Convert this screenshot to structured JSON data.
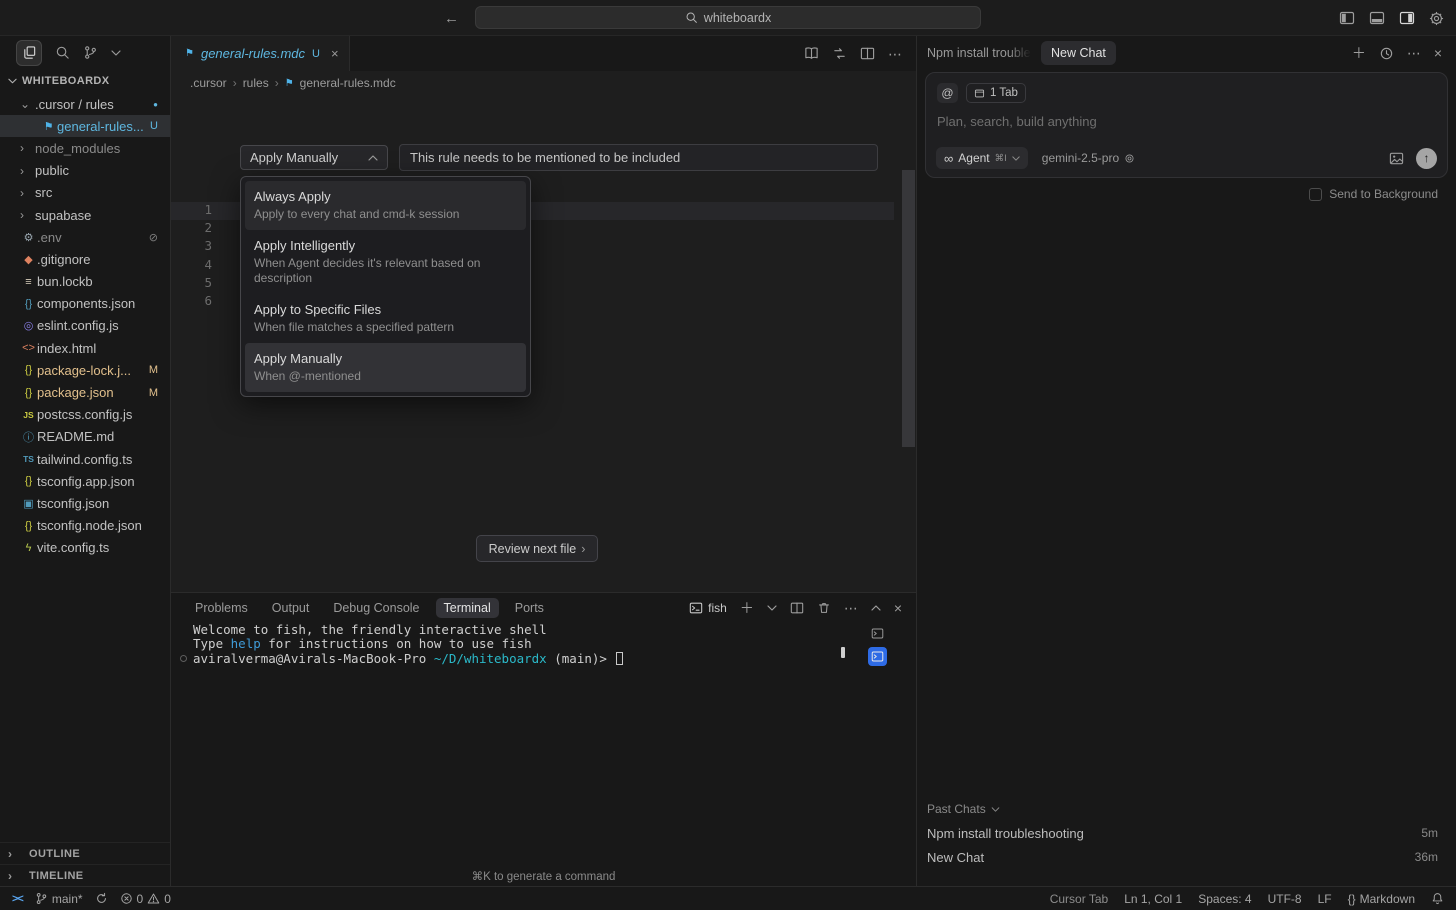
{
  "colors": {
    "untracked": "#5eb7e0",
    "modified": "#e2c08d",
    "accent": "#4daafc",
    "terminal_path": "#2bb9c9",
    "terminal_command": "#3f9bd8",
    "active_terminal_tile": "#2e6be5",
    "remote": "#5aa7f2"
  },
  "title_bar": {
    "search": "whiteboardx"
  },
  "sidebar": {
    "root_label": "WHITEBOARDX",
    "items": [
      {
        "chev": "⌄",
        "name": ".cursor / rules",
        "badge": "●",
        "badge_class": "b-dot"
      },
      {
        "glyph": "⚑",
        "glyph_class": "ic-rule",
        "name": "general-rules....",
        "name_class": "untracked",
        "badge": "U",
        "badge_class": "b-u",
        "row_class": "selected ind1"
      },
      {
        "chev": "›",
        "name": "node_modules",
        "name_class": "dim"
      },
      {
        "chev": "›",
        "name": "public"
      },
      {
        "chev": "›",
        "name": "src"
      },
      {
        "chev": "›",
        "name": "supabase"
      },
      {
        "glyph": "⚙",
        "glyph_class": "ic-gray",
        "name": ".env",
        "name_class": "dim",
        "badge": "⊘",
        "badge_class": "b-ign"
      },
      {
        "glyph": "◆",
        "glyph_class": "ic-orange",
        "name": ".gitignore"
      },
      {
        "glyph": "≡",
        "glyph_class": "ic-beige",
        "name": "bun.lockb"
      },
      {
        "glyph": "{}",
        "glyph_class": "ic-teal",
        "name": "components.json"
      },
      {
        "glyph": "◎",
        "glyph_class": "ic-purple",
        "name": "eslint.config.js"
      },
      {
        "glyph": "<>",
        "glyph_class": "ic-orange",
        "name": "index.html"
      },
      {
        "glyph": "{}",
        "glyph_class": "ic-yellow",
        "name": "package-lock.j...",
        "name_class": "modified",
        "badge": "M",
        "badge_class": "b-m"
      },
      {
        "glyph": "{}",
        "glyph_class": "ic-yellow",
        "name": "package.json",
        "name_class": "modified",
        "badge": "M",
        "badge_class": "b-m"
      },
      {
        "glyph": "JS",
        "glyph_class": "ic-yellow ic-txt",
        "name": "postcss.config.js"
      },
      {
        "glyph": "ⓘ",
        "glyph_class": "ic-blue",
        "name": "README.md"
      },
      {
        "glyph": "TS",
        "glyph_class": "ic-blue ic-txt",
        "name": "tailwind.config.ts"
      },
      {
        "glyph": "{}",
        "glyph_class": "ic-yellow",
        "name": "tsconfig.app.json"
      },
      {
        "glyph": "▣",
        "glyph_class": "ic-blue",
        "name": "tsconfig.json"
      },
      {
        "glyph": "{}",
        "glyph_class": "ic-yellow",
        "name": "tsconfig.node.json"
      },
      {
        "glyph": "ϟ",
        "glyph_class": "ic-lime",
        "name": "vite.config.ts"
      }
    ],
    "outline_label": "OUTLINE",
    "timeline_label": "TIMELINE"
  },
  "editor": {
    "tab": {
      "label": "general-rules.mdc",
      "badge": "U"
    },
    "breadcrumbs": [
      ".cursor",
      "rules",
      "general-rules.mdc"
    ],
    "rule_type": "Apply Manually",
    "rule_description": "This rule needs to be mentioned to be included",
    "menu": [
      {
        "title": "Always Apply",
        "desc": "Apply to every chat and cmd-k session",
        "state": "hover"
      },
      {
        "title": "Apply Intelligently",
        "desc": "When Agent decides it's relevant based on description"
      },
      {
        "title": "Apply to Specific Files",
        "desc": "When file matches a specified pattern"
      },
      {
        "title": "Apply Manually",
        "desc": "When @-mentioned",
        "state": "selected"
      }
    ],
    "line_numbers": [
      "1",
      "2",
      "3",
      "4",
      "5",
      "6"
    ],
    "review_button": "Review next file"
  },
  "panel": {
    "tabs": [
      {
        "label": "Problems"
      },
      {
        "label": "Output"
      },
      {
        "label": "Debug Console"
      },
      {
        "label": "Terminal",
        "state": "active"
      },
      {
        "label": "Ports"
      }
    ],
    "shell_name": "fish",
    "terminal": {
      "line1": "Welcome to fish, the friendly interactive shell",
      "line2_pre": "Type ",
      "line2_cmd": "help",
      "line2_post": " for instructions on how to use fish",
      "prompt_user": "aviralverma@Avirals-MacBook-Pro ",
      "prompt_path": "~/D/whiteboardx ",
      "prompt_git": "(main)> "
    },
    "hint": "⌘K to generate a command"
  },
  "chat": {
    "tab_previous": "Npm install troubleshooting",
    "tab_active": "New Chat",
    "at_symbol": "@",
    "context_chip": "1 Tab",
    "placeholder": "Plan, search, build anything",
    "agent_infinity": "∞",
    "agent_label": "Agent",
    "agent_kbd": "⌘I",
    "model": "gemini-2.5-pro",
    "send_to_background": "Send to Background",
    "past_chats_label": "Past Chats",
    "past_chats": [
      {
        "name": "Npm install troubleshooting",
        "time": "5m"
      },
      {
        "name": "New Chat",
        "time": "36m"
      }
    ]
  },
  "status_bar": {
    "branch": "main*",
    "error_count": "0",
    "warning_count": "0",
    "cursor_tab": "Cursor Tab",
    "position": "Ln 1, Col 1",
    "indentation": "Spaces: 4",
    "encoding": "UTF-8",
    "eol": "LF",
    "braces": "{}",
    "language": "Markdown"
  }
}
